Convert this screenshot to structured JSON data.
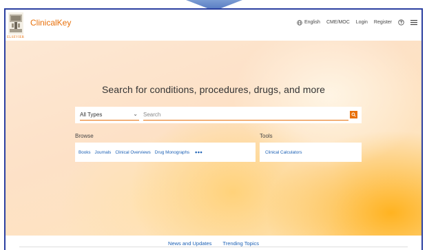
{
  "header": {
    "brand": "ClinicalKey",
    "publisher": "ELSEVIER",
    "nav": {
      "language": "English",
      "cme": "CME/MOC",
      "login": "Login",
      "register": "Register"
    }
  },
  "hero": {
    "headline": "Search for conditions, procedures, drugs, and more",
    "search": {
      "type_selected": "All Types",
      "placeholder": "Search"
    }
  },
  "browse": {
    "label": "Browse",
    "items": [
      "Books",
      "Journals",
      "Clinical Overviews",
      "Drug Monographs"
    ],
    "more": "•••"
  },
  "tools": {
    "label": "Tools",
    "items": [
      "Clinical Calculators"
    ]
  },
  "footer": {
    "tabs": [
      "News and Updates",
      "Trending Topics"
    ]
  },
  "colors": {
    "brand_orange": "#e8700a",
    "link_blue": "#1a5fb4",
    "frame_border": "#2a3fa0"
  }
}
